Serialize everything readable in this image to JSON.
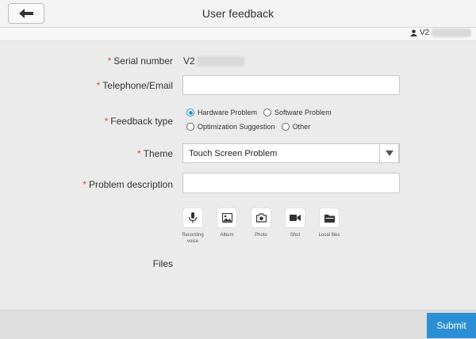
{
  "header": {
    "title": "User feedback"
  },
  "user": {
    "name_prefix": "V2"
  },
  "form": {
    "serial_label": "Serial number",
    "serial_value": "V2",
    "contact_label": "Telephone/Email",
    "contact_value": "",
    "feedback_type_label": "Feedback type",
    "feedback_types": [
      {
        "label": "Hardware Problem",
        "selected": true
      },
      {
        "label": "Software Problem",
        "selected": false
      },
      {
        "label": "Optimization Suggestion",
        "selected": false
      },
      {
        "label": "Other",
        "selected": false
      }
    ],
    "theme_label": "Theme",
    "theme_value": "Touch Screen Problem",
    "description_label": "Problem description",
    "description_value": "",
    "files_label": "Files"
  },
  "attachments": [
    {
      "label": "Recording voice",
      "icon": "microphone-icon"
    },
    {
      "label": "Album",
      "icon": "image-icon"
    },
    {
      "label": "Photo",
      "icon": "camera-icon"
    },
    {
      "label": "Shot",
      "icon": "video-camera-icon"
    },
    {
      "label": "Local files",
      "icon": "folder-icon"
    }
  ],
  "footer": {
    "submit_label": "Submit"
  },
  "colors": {
    "accent": "#2b8fd6",
    "required": "#e0483e"
  }
}
